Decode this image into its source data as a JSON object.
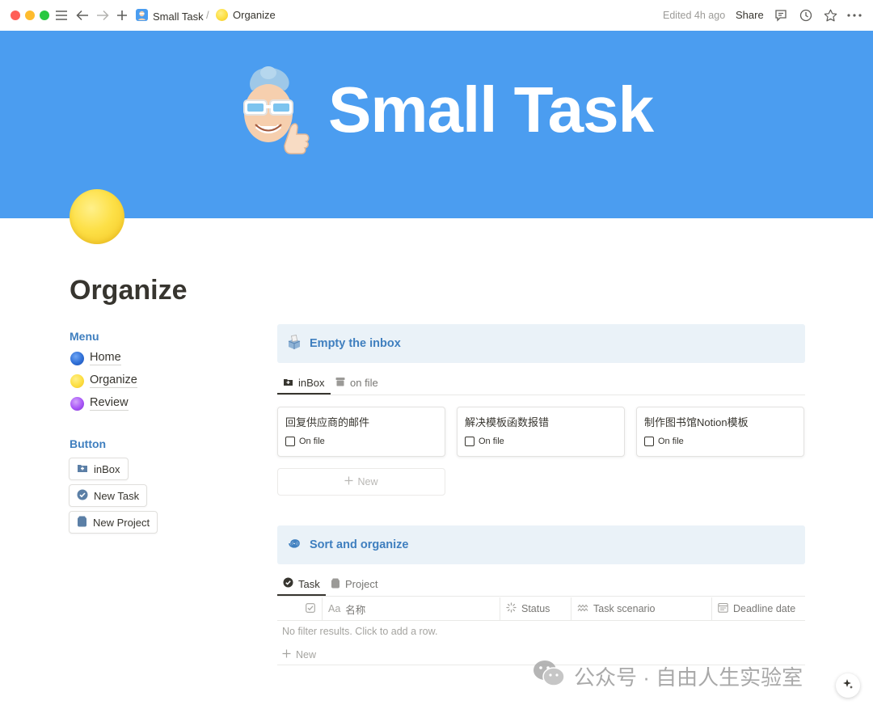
{
  "breadcrumb": {
    "workspace": "Small Task",
    "separator": "/",
    "page": "Organize"
  },
  "topbar": {
    "edited": "Edited 4h ago",
    "share": "Share"
  },
  "cover": {
    "title": "Small Task",
    "color": "#4b9df0"
  },
  "page": {
    "title": "Organize"
  },
  "menu": {
    "label": "Menu",
    "items": [
      {
        "label": "Home",
        "color": "#2f6fd6"
      },
      {
        "label": "Organize",
        "color": "#fde047"
      },
      {
        "label": "Review",
        "color": "#a855f7"
      }
    ]
  },
  "buttons": {
    "label": "Button",
    "items": [
      {
        "label": "inBox"
      },
      {
        "label": "New Task"
      },
      {
        "label": "New Project"
      }
    ]
  },
  "inbox": {
    "title": "Empty the inbox",
    "tabs": [
      {
        "label": "inBox"
      },
      {
        "label": "on file"
      }
    ],
    "cards": [
      {
        "title": "回复供应商的邮件",
        "check_label": "On file"
      },
      {
        "title": "解决模板函数报错",
        "check_label": "On file"
      },
      {
        "title": "制作图书馆Notion模板",
        "check_label": "On file"
      }
    ],
    "new_label": "New"
  },
  "organize": {
    "title": "Sort and organize",
    "tabs": [
      {
        "label": "Task"
      },
      {
        "label": "Project"
      }
    ],
    "columns": [
      {
        "label": "名称",
        "prefix": "Aa"
      },
      {
        "label": "Status"
      },
      {
        "label": "Task scenario"
      },
      {
        "label": "Deadline date"
      }
    ],
    "empty_text": "No filter results. Click to add a row.",
    "new_label": "New"
  },
  "watermark": {
    "text": "公众号 · 自由人生实验室"
  },
  "accent_color": "#3f7fbf"
}
